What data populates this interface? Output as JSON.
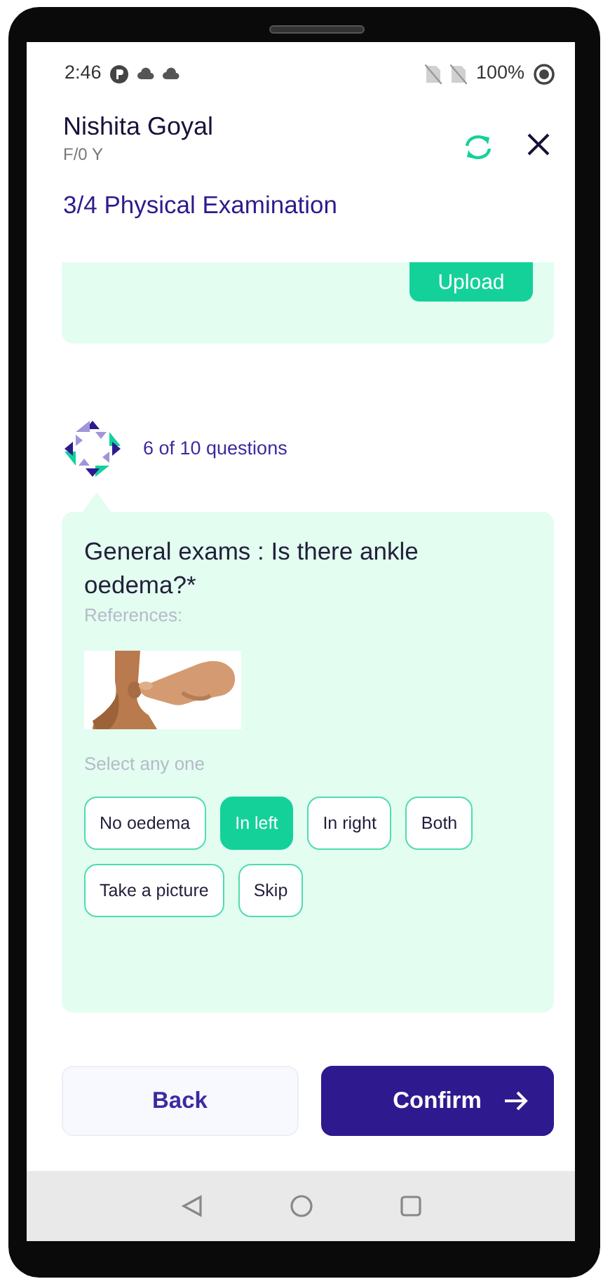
{
  "status_bar": {
    "time": "2:46",
    "battery": "100%"
  },
  "header": {
    "name": "Nishita Goyal",
    "subtitle": "F/0 Y",
    "section": "3/4 Physical Examination"
  },
  "upload_card": {
    "button": "Upload"
  },
  "progress": {
    "text": "6 of 10 questions"
  },
  "question": {
    "text": "General exams : Is there ankle oedema?*",
    "references_label": "References:",
    "hint": "Select any one",
    "options": [
      {
        "label": "No oedema",
        "selected": false
      },
      {
        "label": "In left",
        "selected": true
      },
      {
        "label": "In right",
        "selected": false
      },
      {
        "label": "Both",
        "selected": false
      },
      {
        "label": "Take a picture",
        "selected": false
      },
      {
        "label": "Skip",
        "selected": false
      }
    ]
  },
  "footer": {
    "back": "Back",
    "confirm": "Confirm"
  }
}
